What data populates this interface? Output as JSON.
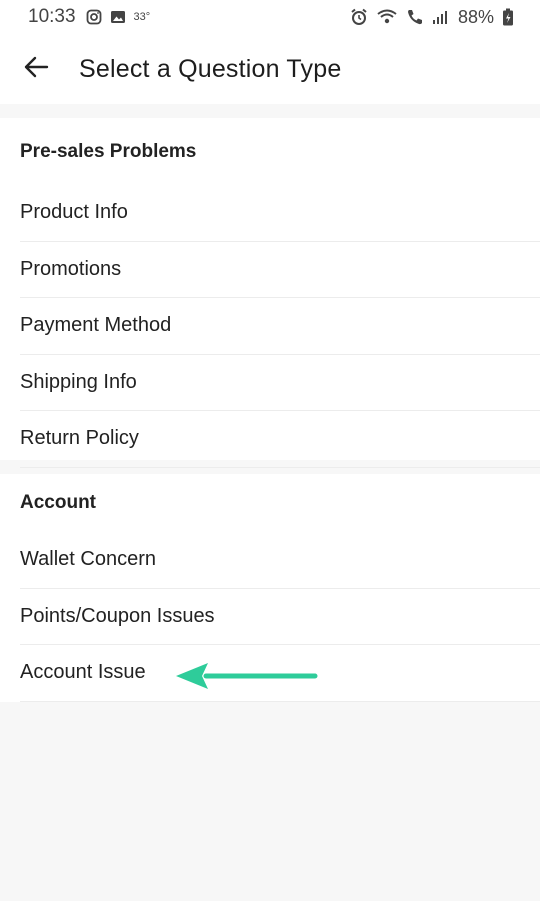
{
  "status_bar": {
    "time": "10:33",
    "temperature": "33°",
    "battery": "88%"
  },
  "header": {
    "title": "Select a Question Type"
  },
  "sections": [
    {
      "title": "Pre-sales Problems",
      "items": [
        "Product Info",
        "Promotions",
        "Payment Method",
        "Shipping Info",
        "Return Policy"
      ]
    },
    {
      "title": "Account",
      "items": [
        "Wallet Concern",
        "Points/Coupon Issues",
        "Account Issue"
      ]
    }
  ],
  "colors": {
    "arrow": "#2ecc9a",
    "background": "#f7f7f7"
  },
  "icons": [
    "instagram-icon",
    "gallery-icon",
    "alarm-icon",
    "wifi-calling-icon",
    "signal-icon",
    "battery-icon",
    "back-arrow-icon",
    "annotation-arrow-icon"
  ]
}
